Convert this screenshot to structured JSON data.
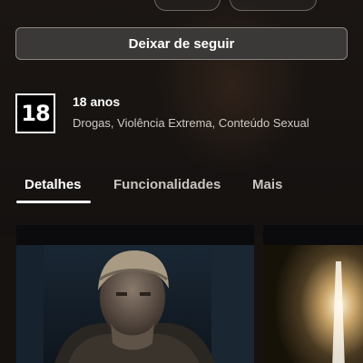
{
  "follow_section": {
    "unfollow_label": "Deixar de seguir"
  },
  "rating": {
    "badge": "18",
    "title": "18 anos",
    "descriptors": "Drogas, Violência Extrema, Conteúdo Sexual"
  },
  "tabs": [
    {
      "label": "Detalhes",
      "active": true
    },
    {
      "label": "Funcionalidades",
      "active": false
    },
    {
      "label": "Mais",
      "active": false
    }
  ],
  "gallery": {
    "items": [
      {
        "icon": "screenshot-viking-warrior"
      },
      {
        "icon": "screenshot-glowing-light"
      }
    ]
  }
}
